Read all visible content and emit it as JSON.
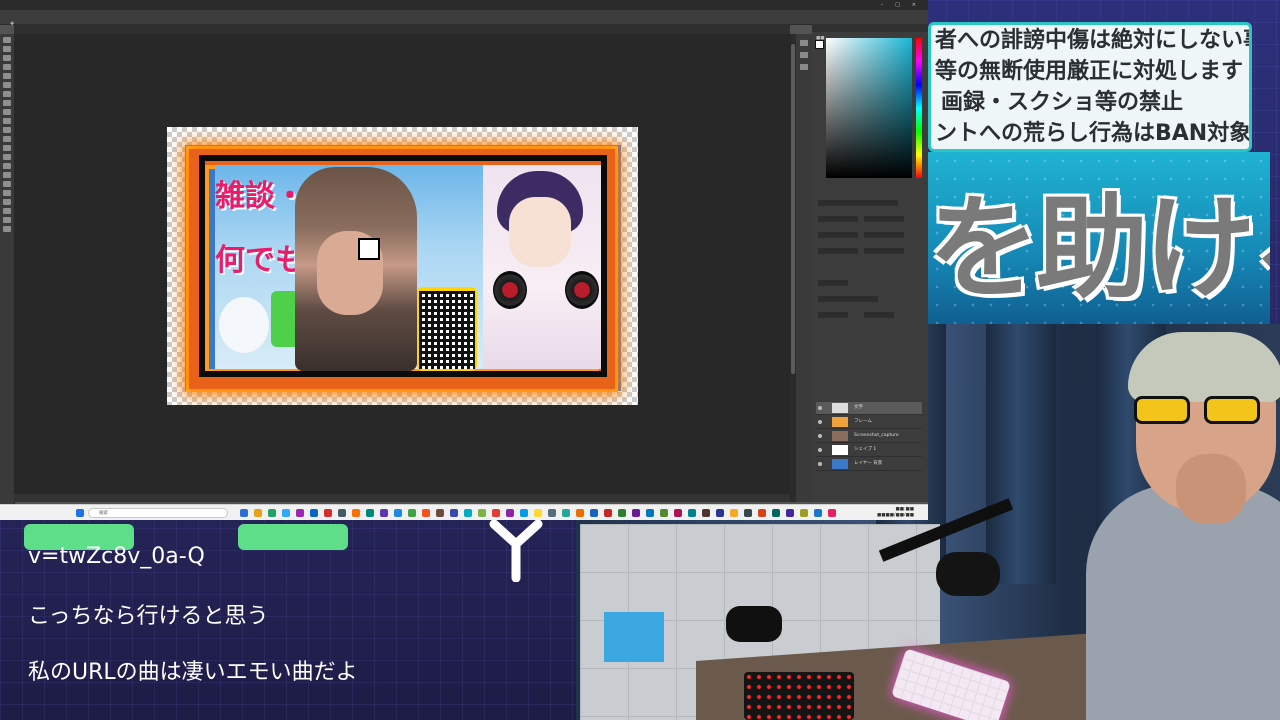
{
  "stream": {
    "rules_lines": [
      "者への誹謗中傷は絶対にしない事",
      "等の無断使用厳正に対処します",
      "画録・スクショ等の禁止",
      "ントへの荒らし行為はBAN対象"
    ],
    "help_banner_text": "を助ける",
    "chat_lines": [
      "v=twZc8v_0a-Q",
      "こっちなら行けると思う",
      "私のURLの曲は凄いエモい曲だよ"
    ],
    "colors": {
      "rules_border": "#2ec6c4",
      "banner_blue": "#1688b6",
      "chat_pill": "#5fde8a"
    }
  },
  "photoshop": {
    "canvas": {
      "title_line1": "雑談・何でも",
      "title_line2": "何でも"
    },
    "layers": [
      {
        "name": "文字",
        "selected": true
      },
      {
        "name": "フレーム"
      },
      {
        "name": "Screenshot_capture"
      },
      {
        "name": "シェイプ 1"
      },
      {
        "name": "レイヤー 背景"
      }
    ],
    "color_picker": {
      "hue": "#1bb6d5"
    }
  },
  "taskbar": {
    "search_placeholder": "検索"
  },
  "icons": [
    "search-icon",
    "windows-start-icon",
    "eye-icon",
    "move-tool-icon",
    "close-icon",
    "minimize-icon",
    "maximize-icon"
  ]
}
